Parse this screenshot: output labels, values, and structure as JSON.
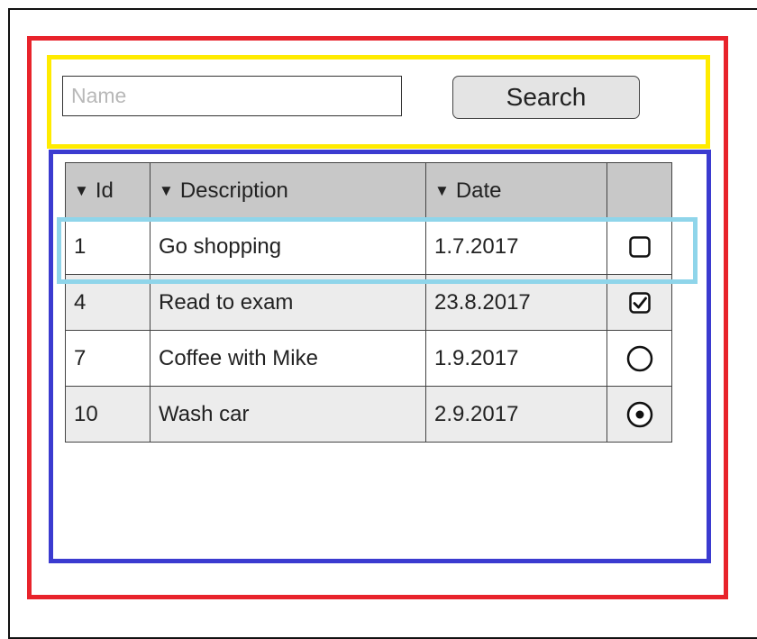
{
  "search": {
    "placeholder": "Name",
    "value": "",
    "button_label": "Search"
  },
  "table": {
    "columns": [
      {
        "label": "Id",
        "icon": "caret-down-icon"
      },
      {
        "label": "Description",
        "icon": "caret-down-icon"
      },
      {
        "label": "Date",
        "icon": "caret-down-icon"
      }
    ],
    "rows": [
      {
        "id": "1",
        "description": "Go shopping",
        "date": "1.7.2017",
        "control": "checkbox",
        "checked": false
      },
      {
        "id": "4",
        "description": "Read to exam",
        "date": "23.8.2017",
        "control": "checkbox",
        "checked": true
      },
      {
        "id": "7",
        "description": "Coffee with Mike",
        "date": "1.9.2017",
        "control": "radio",
        "checked": false
      },
      {
        "id": "10",
        "description": "Wash car",
        "date": "2.9.2017",
        "control": "radio",
        "checked": true
      }
    ]
  },
  "annotation_colors": {
    "page_region": "#e8232b",
    "search_region": "#ffeb00",
    "table_region": "#3b3bd0",
    "row_highlight": "#8fd5ea"
  }
}
